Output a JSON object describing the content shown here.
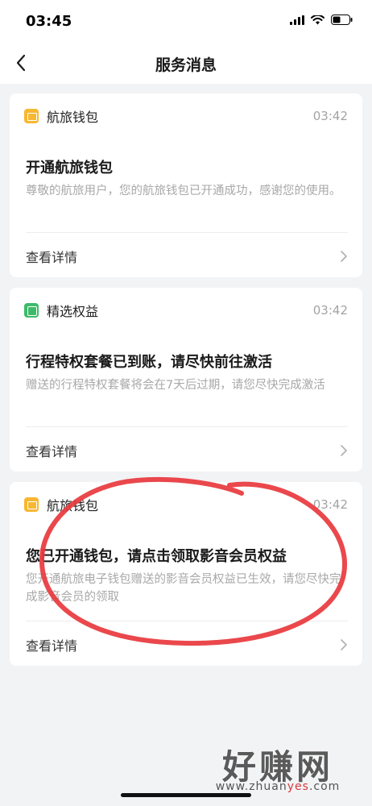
{
  "status_bar": {
    "time": "03:45"
  },
  "nav": {
    "title": "服务消息"
  },
  "cards": [
    {
      "app_name": "航旅钱包",
      "time": "03:42",
      "title": "开通航旅钱包",
      "desc": "尊敬的航旅用户，您的航旅钱包已开通成功，感谢您的使用。",
      "detail_label": "查看详情"
    },
    {
      "app_name": "精选权益",
      "time": "03:42",
      "title": "行程特权套餐已到账，请尽快前往激活",
      "desc": "赠送的行程特权套餐将会在7天后过期，请您尽快完成激活",
      "detail_label": "查看详情"
    },
    {
      "app_name": "航旅钱包",
      "time": "03:42",
      "title": "您已开通钱包，请点击领取影音会员权益",
      "desc": "您开通航旅电子钱包赠送的影音会员权益已生效，请您尽快完成影音会员的领取",
      "detail_label": "查看详情"
    }
  ],
  "watermark": {
    "main": "好赚网",
    "url_prefix": "www.zhuan",
    "url_highlight": "yes",
    "url_suffix": ".com"
  },
  "icons": {
    "back": "chevron-left-icon",
    "detail": "chevron-right-icon",
    "wallet_app": "wallet-icon",
    "benefit_app": "benefit-icon"
  },
  "colors": {
    "annotation": "#e8383d",
    "wallet_icon": "#f7b731",
    "benefit_icon": "#3dbb6a"
  }
}
